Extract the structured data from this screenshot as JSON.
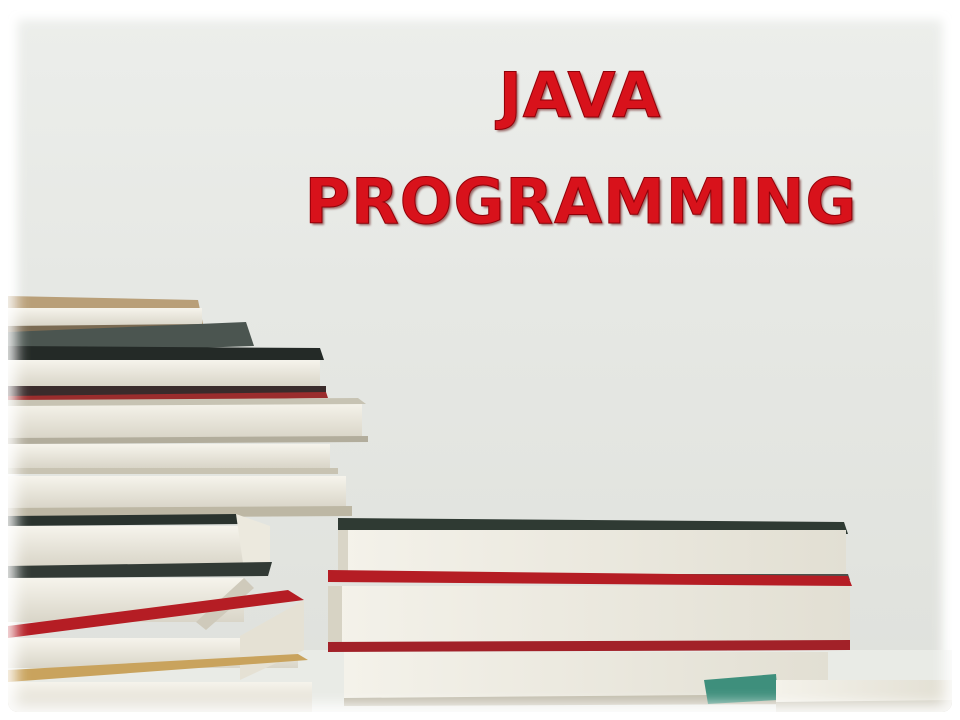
{
  "slide": {
    "title_line_1": "JAVA",
    "title_line_2": "PROGRAMMING"
  },
  "colors": {
    "title": "#d8121b",
    "background": "#e6e8e4",
    "page_white": "#f3f1e8",
    "cover_dark": "#2f3a33",
    "cover_red": "#b51d24",
    "cover_teal": "#3e8f7c"
  },
  "image": {
    "subject": "stacked-books-photo"
  }
}
